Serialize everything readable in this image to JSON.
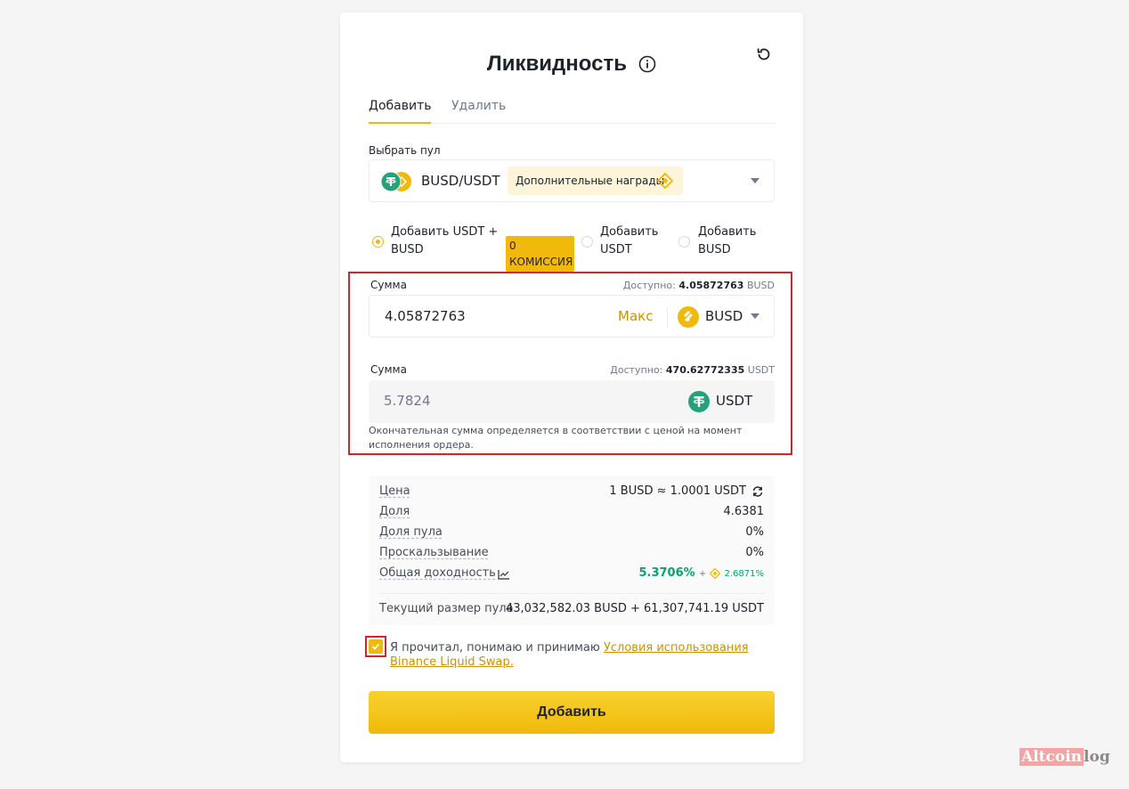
{
  "header": {
    "title": "Ликвидность"
  },
  "tabs": [
    {
      "label": "Добавить",
      "active": true
    },
    {
      "label": "Удалить",
      "active": false
    }
  ],
  "pool": {
    "label": "Выбрать пул",
    "name": "BUSD/USDT",
    "badge": "Дополнительные награды"
  },
  "modes": [
    {
      "label_line1": "Добавить USDT +",
      "label_line2": "BUSD",
      "checked": true
    },
    {
      "label_line1": "Добавить",
      "label_line2": "USDT",
      "checked": false
    },
    {
      "label_line1": "Добавить",
      "label_line2": "BUSD",
      "checked": false
    }
  ],
  "fee_badge": {
    "line1": "0",
    "line2": "КОМИССИЯ"
  },
  "amount1": {
    "label": "Сумма",
    "available_prefix": "Доступно:",
    "available_value": "4.05872763",
    "available_unit": "BUSD",
    "value": "4.05872763",
    "max_label": "Макс",
    "coin": "BUSD"
  },
  "amount2": {
    "label": "Сумма",
    "available_prefix": "Доступно:",
    "available_value": "470.62772335",
    "available_unit": "USDT",
    "value": "5.7824",
    "coin": "USDT"
  },
  "note": "Окончательная сумма определяется в соответствии с ценой на момент исполнения ордера.",
  "details": {
    "price_label": "Цена",
    "price_value": "1 BUSD ≈ 1.0001 USDT",
    "share_label": "Доля",
    "share_value": "4.6381",
    "pool_share_label": "Доля пула",
    "pool_share_value": "0%",
    "slippage_label": "Проскальзывание",
    "slippage_value": "0%",
    "apy_label": "Общая доходность",
    "apy_value": "5.3706%",
    "apy_plus": "+",
    "apy_bonus": "2.6871%",
    "pool_size_label": "Текущий размер пула",
    "pool_size_value": "43,032,582.03 BUSD + 61,307,741.19 USDT"
  },
  "terms": {
    "checked": true,
    "text": "Я прочитал, понимаю и принимаю",
    "link": "Условия использования Binance Liquid Swap."
  },
  "submit_label": "Добавить",
  "watermark": {
    "part1": "Altcoin",
    "part2": "log"
  },
  "colors": {
    "accent": "#f0b90b",
    "highlight": "#d4242e",
    "positive": "#03a66d",
    "tether": "#26a17b"
  }
}
